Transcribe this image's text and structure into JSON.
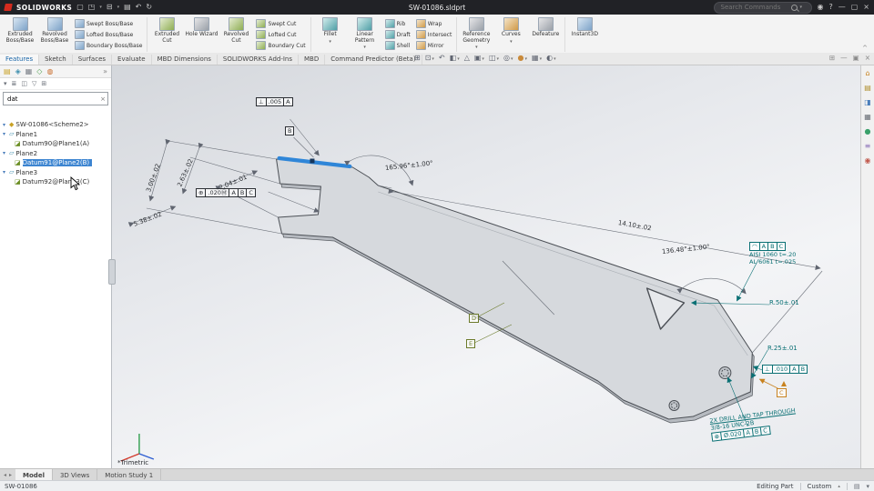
{
  "titlebar": {
    "brand": "SOLIDWORKS",
    "title": "SW-01086.sldprt",
    "search_placeholder": "Search Commands"
  },
  "icons": {
    "new": "▢",
    "open": "◳",
    "save": "⊟",
    "print": "▤",
    "undo": "↶",
    "rebuild": "↻",
    "caret": "▾",
    "caret_up": "▴",
    "login": "◉",
    "help": "?",
    "min": "—",
    "max": "▢",
    "close": "×",
    "doc_tabs": "⊞",
    "doc_min": "—",
    "doc_restore": "▣",
    "doc_close": "×",
    "collapse": "^",
    "zoom_fit": "⊞",
    "zoom_area": "⊡",
    "prev_view": "↶",
    "section": "◧",
    "annot": "△",
    "orient": "▣",
    "display": "◫",
    "hide": "◎",
    "appearance": "●",
    "scene": "▦",
    "settings": "◐",
    "tabs_left": "◂",
    "tabs_right": "▸",
    "clear": "×",
    "panel_more": "»",
    "tree_caret": "▾",
    "part": "◆",
    "plane": "▱",
    "datum": "◪",
    "pt1": "▤",
    "pt2": "◈",
    "pt3": "▦",
    "pt4": "◇",
    "pt5": "◍",
    "f1": "▾",
    "f2": "≣",
    "f3": "◫",
    "f4": "▽",
    "f5": "⊞",
    "tp1": "⌂",
    "tp2": "▤",
    "tp3": "◨",
    "tp4": "▦",
    "tp5": "●",
    "tp6": "≡",
    "tp7": "◉",
    "status_ic1": "▤",
    "status_ic2": "▾"
  },
  "ribbon": {
    "large": [
      "Extruded Boss/Base",
      "Revolved Boss/Base",
      "Extruded Cut",
      "Hole Wizard",
      "Revolved Cut",
      "Fillet",
      "Linear Pattern",
      "Reference Geometry",
      "Curves",
      "Defeature",
      "Instant3D"
    ],
    "col1": [
      "Swept Boss/Base",
      "Lofted Boss/Base",
      "Boundary Boss/Base"
    ],
    "col2": [
      "Swept Cut",
      "Lofted Cut",
      "Boundary Cut"
    ],
    "col3": [
      "Rib",
      "Draft",
      "Shell"
    ],
    "col4": [
      "Wrap",
      "Intersect",
      "Mirror"
    ],
    "tabs": [
      "Features",
      "Sketch",
      "Surfaces",
      "Evaluate",
      "MBD Dimensions",
      "SOLIDWORKS Add-Ins",
      "MBD",
      "Command Predictor (Beta)"
    ]
  },
  "tree": {
    "search_value": "dat",
    "root": "SW-01086<Scheme2>",
    "plane1": "Plane1",
    "datum1": "Datum90@Plane1(A)",
    "plane2": "Plane2",
    "datum2": "Datum91@Plane2(B)",
    "plane3": "Plane3",
    "datum3": "Datum92@Plane3(C)"
  },
  "viewport": {
    "view_label": "*Trimetric",
    "ann": {
      "fcf_top_sym": "⊥",
      "fcf_top_val": ".005",
      "fcf_top_d1": "A",
      "datum_top": "B",
      "dim_300": "3.00±.02",
      "dim_263": "2.63±.02",
      "dim_204": "2.04±.01",
      "dim_538": "5.38±.02",
      "fcf_left_sym": "⊕",
      "fcf_left_val": ".020Ⓜ",
      "fcf_left_d1": "A",
      "fcf_left_d2": "B",
      "fcf_left_d3": "C",
      "ang_165": "165.96°±1.00°",
      "dim_1410": "14.10±.02",
      "ang_136": "136.48°±1.00°",
      "mat_sym": "◠",
      "mat_d1": "A",
      "mat_d2": "B",
      "mat_d3": "C",
      "mat_line1": "AISI 1060 t=.20",
      "mat_line2": "AL 6061 t=.025",
      "r50": "R.50±.01",
      "r25": "R.25±.01",
      "fcf_right_sym": "⊥",
      "fcf_right_val": ".010",
      "fcf_right_d1": "A",
      "fcf_right_d2": "B",
      "datum_c": "C",
      "drill_line1": "2X DRILL AND TAP THROUGH",
      "drill_line2": "3/8-16 UNC-2B",
      "fcf_drill_sym": "⊕",
      "fcf_drill_val": "Ø.020",
      "fcf_drill_d1": "A",
      "fcf_drill_d2": "B",
      "fcf_drill_d3": "C",
      "datum_d": "D",
      "datum_e": "E"
    }
  },
  "bottom_tabs": {
    "t1": "Model",
    "t2": "3D Views",
    "t3": "Motion Study 1"
  },
  "statusbar": {
    "document": "SW-01086",
    "mode": "Editing Part",
    "config": "Custom"
  }
}
